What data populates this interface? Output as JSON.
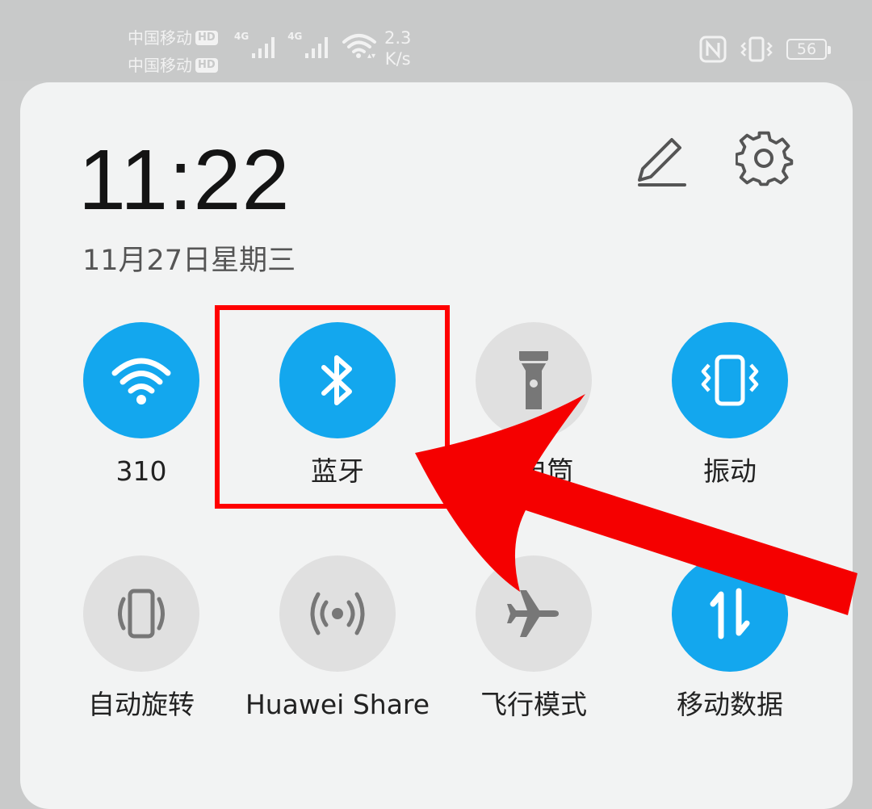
{
  "status_bar": {
    "carrier_1": "中国移动",
    "carrier_2": "中国移动",
    "hd_badge": "HD",
    "network_1": "4G",
    "network_2": "4G",
    "speed_value": "2.3",
    "speed_unit": "K/s",
    "battery_level": "56"
  },
  "header": {
    "time": "11:22",
    "date": "11月27日星期三"
  },
  "tiles": [
    {
      "label": "310",
      "icon": "wifi-icon",
      "active": true
    },
    {
      "label": "蓝牙",
      "icon": "bluetooth-icon",
      "active": true
    },
    {
      "label": "手电筒",
      "icon": "flashlight-icon",
      "active": false
    },
    {
      "label": "振动",
      "icon": "vibrate-icon",
      "active": true
    },
    {
      "label": "自动旋转",
      "icon": "auto-rotate-icon",
      "active": false
    },
    {
      "label": "Huawei Share",
      "icon": "huawei-share-icon",
      "active": false
    },
    {
      "label": "飞行模式",
      "icon": "airplane-icon",
      "active": false
    },
    {
      "label": "移动数据",
      "icon": "mobile-data-icon",
      "active": true
    }
  ],
  "colors": {
    "active_tile": "#13a7ee",
    "inactive_tile": "#e0e0e0",
    "annotation": "#ff0000"
  }
}
